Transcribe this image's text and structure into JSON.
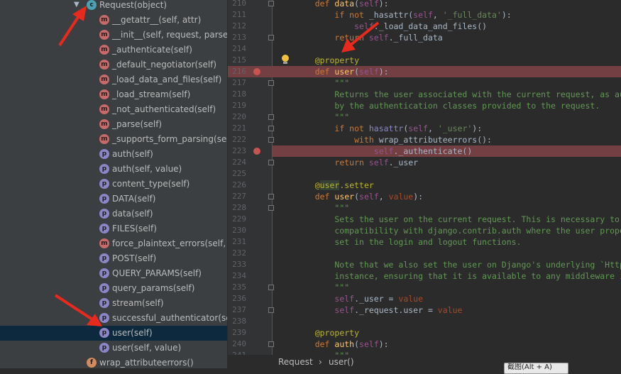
{
  "structure": {
    "items": [
      {
        "label": "Request(object)",
        "icon": "class-icon",
        "letter": "c",
        "type": "c",
        "indent": 1,
        "expanded": true
      },
      {
        "label": "__getattr__(self, attr)",
        "icon": "method-icon",
        "letter": "m",
        "type": "m",
        "indent": 2
      },
      {
        "label": "__init__(self, request, parsers",
        "icon": "method-icon",
        "letter": "m",
        "type": "m",
        "indent": 2
      },
      {
        "label": "_authenticate(self)",
        "icon": "method-icon",
        "letter": "m",
        "type": "m",
        "indent": 2
      },
      {
        "label": "_default_negotiator(self)",
        "icon": "method-icon",
        "letter": "m",
        "type": "m",
        "indent": 2
      },
      {
        "label": "_load_data_and_files(self)",
        "icon": "method-icon",
        "letter": "m",
        "type": "m",
        "indent": 2
      },
      {
        "label": "_load_stream(self)",
        "icon": "method-icon",
        "letter": "m",
        "type": "m",
        "indent": 2
      },
      {
        "label": "_not_authenticated(self)",
        "icon": "method-icon",
        "letter": "m",
        "type": "m",
        "indent": 2
      },
      {
        "label": "_parse(self)",
        "icon": "method-icon",
        "letter": "m",
        "type": "m",
        "indent": 2
      },
      {
        "label": "_supports_form_parsing(self",
        "icon": "method-icon",
        "letter": "m",
        "type": "m",
        "indent": 2
      },
      {
        "label": "auth(self)",
        "icon": "property-icon",
        "letter": "p",
        "type": "p",
        "indent": 2
      },
      {
        "label": "auth(self, value)",
        "icon": "property-icon",
        "letter": "p",
        "type": "p",
        "indent": 2
      },
      {
        "label": "content_type(self)",
        "icon": "property-icon",
        "letter": "p",
        "type": "p",
        "indent": 2
      },
      {
        "label": "DATA(self)",
        "icon": "property-icon",
        "letter": "p",
        "type": "p",
        "indent": 2
      },
      {
        "label": "data(self)",
        "icon": "property-icon",
        "letter": "p",
        "type": "p",
        "indent": 2
      },
      {
        "label": "FILES(self)",
        "icon": "property-icon",
        "letter": "p",
        "type": "p",
        "indent": 2
      },
      {
        "label": "force_plaintext_errors(self, v",
        "icon": "method-icon",
        "letter": "m",
        "type": "m",
        "indent": 2
      },
      {
        "label": "POST(self)",
        "icon": "property-icon",
        "letter": "p",
        "type": "p",
        "indent": 2
      },
      {
        "label": "QUERY_PARAMS(self)",
        "icon": "property-icon",
        "letter": "p",
        "type": "p",
        "indent": 2
      },
      {
        "label": "query_params(self)",
        "icon": "property-icon",
        "letter": "p",
        "type": "p",
        "indent": 2
      },
      {
        "label": "stream(self)",
        "icon": "property-icon",
        "letter": "p",
        "type": "p",
        "indent": 2
      },
      {
        "label": "successful_authenticator(self",
        "icon": "property-icon",
        "letter": "p",
        "type": "p",
        "indent": 2
      },
      {
        "label": "user(self)",
        "icon": "property-icon",
        "letter": "p",
        "type": "p",
        "indent": 2,
        "selected": true
      },
      {
        "label": "user(self, value)",
        "icon": "property-icon",
        "letter": "p",
        "type": "p",
        "indent": 2
      },
      {
        "label": "wrap_attributeerrors()",
        "icon": "function-icon",
        "letter": "f",
        "type": "f",
        "indent": 1
      }
    ]
  },
  "editor": {
    "lines": [
      {
        "num": "210",
        "html": "    <span class='kw'>def </span><span class='fn'>data</span>(<span class='slf'>self</span>):",
        "fold": true
      },
      {
        "num": "211",
        "html": "        <span class='kw'>if not </span>_hasattr(<span class='slf'>self</span>, <span class='str'>'_full_data'</span>):"
      },
      {
        "num": "212",
        "html": "            <span class='slf'>self</span>._load_data_and_files()"
      },
      {
        "num": "213",
        "html": "        <span class='kw'>return </span><span class='slf'>self</span>._full_data",
        "fold": true
      },
      {
        "num": "214",
        "html": ""
      },
      {
        "num": "215",
        "html": "    <span class='dec'>@property</span>",
        "bulb": true
      },
      {
        "num": "216",
        "html": "    <span class='kw'>def </span><span class='fn'>user</span>(<span class='slf'>self</span>):",
        "bp": true,
        "hl": "full"
      },
      {
        "num": "217",
        "html": "        <span class='doc'>\"\"\"</span>",
        "fold": true
      },
      {
        "num": "218",
        "html": "<span class='doc'>        Returns the user associated with the current request, as authe</span>"
      },
      {
        "num": "219",
        "html": "<span class='doc'>        by the authentication classes provided to the request.</span>"
      },
      {
        "num": "220",
        "html": "<span class='doc'>        \"\"\"</span>",
        "fold": true
      },
      {
        "num": "221",
        "html": "        <span class='kw'>if not </span><span class='bi'>hasattr</span>(<span class='slf'>self</span>, <span class='str'>'_user'</span>):",
        "fold": true
      },
      {
        "num": "222",
        "html": "            <span class='kw'>with </span>wrap_attributeerrors():",
        "fold": true
      },
      {
        "num": "223",
        "html": "                <span class='slf'>self</span>._authenticate()",
        "bp": true,
        "hl": "partial"
      },
      {
        "num": "224",
        "html": "        <span class='kw'>return </span><span class='slf'>self</span>._user",
        "fold": true
      },
      {
        "num": "225",
        "html": ""
      },
      {
        "num": "226",
        "html": "    <span class='dec'>@<span class='hl'>user</span>.setter</span>"
      },
      {
        "num": "227",
        "html": "    <span class='kw'>def </span><span class='fn'>user</span>(<span class='slf'>self</span>, <span class='prm'>value</span>):",
        "fold": true
      },
      {
        "num": "228",
        "html": "        <span class='doc'>\"\"\"</span>",
        "fold": true
      },
      {
        "num": "229",
        "html": "<span class='doc'>        Sets the user on the current request. This is necessary to mai</span>"
      },
      {
        "num": "230",
        "html": "<span class='doc'>        compatibility with django.contrib.auth where the user property</span>"
      },
      {
        "num": "231",
        "html": "<span class='doc'>        set in the login and logout functions.</span>"
      },
      {
        "num": "232",
        "html": ""
      },
      {
        "num": "233",
        "html": "<span class='doc'>        Note that we also set the user on Django's underlying `HttpRed</span>"
      },
      {
        "num": "234",
        "html": "<span class='doc'>        instance, ensuring that it is available to any middleware in t</span>"
      },
      {
        "num": "235",
        "html": "<span class='doc'>        \"\"\"</span>",
        "fold": true
      },
      {
        "num": "236",
        "html": "        <span class='slf'>self</span>._user = <span class='prm'>value</span>"
      },
      {
        "num": "237",
        "html": "        <span class='slf'>self</span>._request.user = <span class='prm'>value</span>",
        "fold": true
      },
      {
        "num": "238",
        "html": ""
      },
      {
        "num": "239",
        "html": "    <span class='dec'>@property</span>"
      },
      {
        "num": "240",
        "html": "    <span class='kw'>def </span><span class='fn'>auth</span>(<span class='slf'>self</span>):",
        "fold": true
      },
      {
        "num": "241",
        "html": "        <span class='doc'>\"\"\"</span>"
      }
    ]
  },
  "breadcrumb": {
    "class_name": "Request",
    "separator": "›",
    "method_name": "user()"
  },
  "tooltip": {
    "text": "截图(Alt + A)"
  },
  "colors": {
    "annotation_arrow": "#e8291e",
    "breakpoint": "#c75450",
    "selection": "#0d293e"
  }
}
